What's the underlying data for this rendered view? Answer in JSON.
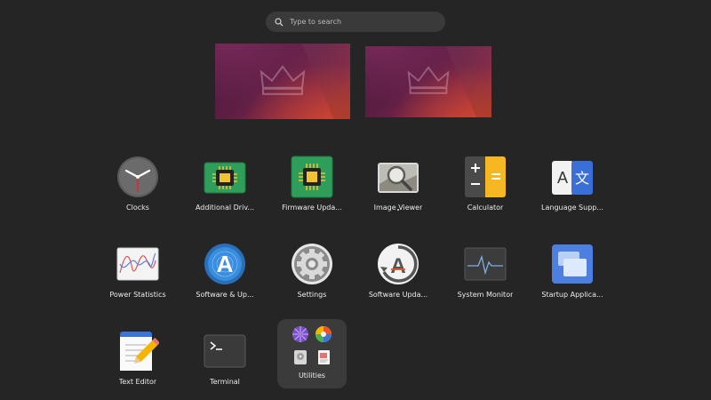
{
  "search": {
    "placeholder": "Type to search"
  },
  "workspaces": [
    {
      "name": "workspace-1"
    },
    {
      "name": "workspace-2"
    }
  ],
  "apps": [
    {
      "id": "clocks",
      "label": "Clocks"
    },
    {
      "id": "additional-drivers",
      "label": "Additional Driv..."
    },
    {
      "id": "firmware-updater",
      "label": "Firmware Upda..."
    },
    {
      "id": "image-viewer",
      "label": "Image Viewer"
    },
    {
      "id": "calculator",
      "label": "Calculator"
    },
    {
      "id": "language-support",
      "label": "Language Supp..."
    },
    {
      "id": "power-statistics",
      "label": "Power Statistics"
    },
    {
      "id": "software-updates",
      "label": "Software & Up..."
    },
    {
      "id": "settings",
      "label": "Settings"
    },
    {
      "id": "software-updater",
      "label": "Software Upda..."
    },
    {
      "id": "system-monitor",
      "label": "System Monitor"
    },
    {
      "id": "startup-applications",
      "label": "Startup Applica..."
    },
    {
      "id": "text-editor",
      "label": "Text Editor"
    },
    {
      "id": "terminal",
      "label": "Terminal"
    },
    {
      "id": "utilities",
      "label": "Utilities"
    }
  ],
  "colors": {
    "background": "#252525",
    "accent": "#e95420"
  }
}
